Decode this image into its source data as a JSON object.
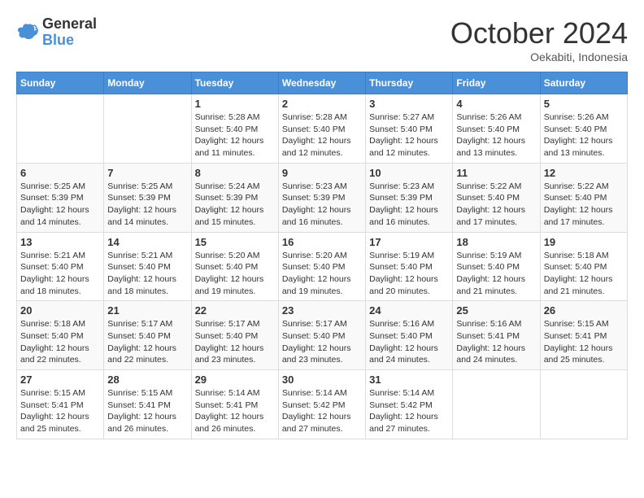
{
  "header": {
    "logo_general": "General",
    "logo_blue": "Blue",
    "month_title": "October 2024",
    "location": "Oekabiti, Indonesia"
  },
  "days_of_week": [
    "Sunday",
    "Monday",
    "Tuesday",
    "Wednesday",
    "Thursday",
    "Friday",
    "Saturday"
  ],
  "weeks": [
    [
      {
        "day": "",
        "info": ""
      },
      {
        "day": "",
        "info": ""
      },
      {
        "day": "1",
        "info": "Sunrise: 5:28 AM\nSunset: 5:40 PM\nDaylight: 12 hours and 11 minutes."
      },
      {
        "day": "2",
        "info": "Sunrise: 5:28 AM\nSunset: 5:40 PM\nDaylight: 12 hours and 12 minutes."
      },
      {
        "day": "3",
        "info": "Sunrise: 5:27 AM\nSunset: 5:40 PM\nDaylight: 12 hours and 12 minutes."
      },
      {
        "day": "4",
        "info": "Sunrise: 5:26 AM\nSunset: 5:40 PM\nDaylight: 12 hours and 13 minutes."
      },
      {
        "day": "5",
        "info": "Sunrise: 5:26 AM\nSunset: 5:40 PM\nDaylight: 12 hours and 13 minutes."
      }
    ],
    [
      {
        "day": "6",
        "info": "Sunrise: 5:25 AM\nSunset: 5:39 PM\nDaylight: 12 hours and 14 minutes."
      },
      {
        "day": "7",
        "info": "Sunrise: 5:25 AM\nSunset: 5:39 PM\nDaylight: 12 hours and 14 minutes."
      },
      {
        "day": "8",
        "info": "Sunrise: 5:24 AM\nSunset: 5:39 PM\nDaylight: 12 hours and 15 minutes."
      },
      {
        "day": "9",
        "info": "Sunrise: 5:23 AM\nSunset: 5:39 PM\nDaylight: 12 hours and 16 minutes."
      },
      {
        "day": "10",
        "info": "Sunrise: 5:23 AM\nSunset: 5:39 PM\nDaylight: 12 hours and 16 minutes."
      },
      {
        "day": "11",
        "info": "Sunrise: 5:22 AM\nSunset: 5:40 PM\nDaylight: 12 hours and 17 minutes."
      },
      {
        "day": "12",
        "info": "Sunrise: 5:22 AM\nSunset: 5:40 PM\nDaylight: 12 hours and 17 minutes."
      }
    ],
    [
      {
        "day": "13",
        "info": "Sunrise: 5:21 AM\nSunset: 5:40 PM\nDaylight: 12 hours and 18 minutes."
      },
      {
        "day": "14",
        "info": "Sunrise: 5:21 AM\nSunset: 5:40 PM\nDaylight: 12 hours and 18 minutes."
      },
      {
        "day": "15",
        "info": "Sunrise: 5:20 AM\nSunset: 5:40 PM\nDaylight: 12 hours and 19 minutes."
      },
      {
        "day": "16",
        "info": "Sunrise: 5:20 AM\nSunset: 5:40 PM\nDaylight: 12 hours and 19 minutes."
      },
      {
        "day": "17",
        "info": "Sunrise: 5:19 AM\nSunset: 5:40 PM\nDaylight: 12 hours and 20 minutes."
      },
      {
        "day": "18",
        "info": "Sunrise: 5:19 AM\nSunset: 5:40 PM\nDaylight: 12 hours and 21 minutes."
      },
      {
        "day": "19",
        "info": "Sunrise: 5:18 AM\nSunset: 5:40 PM\nDaylight: 12 hours and 21 minutes."
      }
    ],
    [
      {
        "day": "20",
        "info": "Sunrise: 5:18 AM\nSunset: 5:40 PM\nDaylight: 12 hours and 22 minutes."
      },
      {
        "day": "21",
        "info": "Sunrise: 5:17 AM\nSunset: 5:40 PM\nDaylight: 12 hours and 22 minutes."
      },
      {
        "day": "22",
        "info": "Sunrise: 5:17 AM\nSunset: 5:40 PM\nDaylight: 12 hours and 23 minutes."
      },
      {
        "day": "23",
        "info": "Sunrise: 5:17 AM\nSunset: 5:40 PM\nDaylight: 12 hours and 23 minutes."
      },
      {
        "day": "24",
        "info": "Sunrise: 5:16 AM\nSunset: 5:40 PM\nDaylight: 12 hours and 24 minutes."
      },
      {
        "day": "25",
        "info": "Sunrise: 5:16 AM\nSunset: 5:41 PM\nDaylight: 12 hours and 24 minutes."
      },
      {
        "day": "26",
        "info": "Sunrise: 5:15 AM\nSunset: 5:41 PM\nDaylight: 12 hours and 25 minutes."
      }
    ],
    [
      {
        "day": "27",
        "info": "Sunrise: 5:15 AM\nSunset: 5:41 PM\nDaylight: 12 hours and 25 minutes."
      },
      {
        "day": "28",
        "info": "Sunrise: 5:15 AM\nSunset: 5:41 PM\nDaylight: 12 hours and 26 minutes."
      },
      {
        "day": "29",
        "info": "Sunrise: 5:14 AM\nSunset: 5:41 PM\nDaylight: 12 hours and 26 minutes."
      },
      {
        "day": "30",
        "info": "Sunrise: 5:14 AM\nSunset: 5:42 PM\nDaylight: 12 hours and 27 minutes."
      },
      {
        "day": "31",
        "info": "Sunrise: 5:14 AM\nSunset: 5:42 PM\nDaylight: 12 hours and 27 minutes."
      },
      {
        "day": "",
        "info": ""
      },
      {
        "day": "",
        "info": ""
      }
    ]
  ]
}
